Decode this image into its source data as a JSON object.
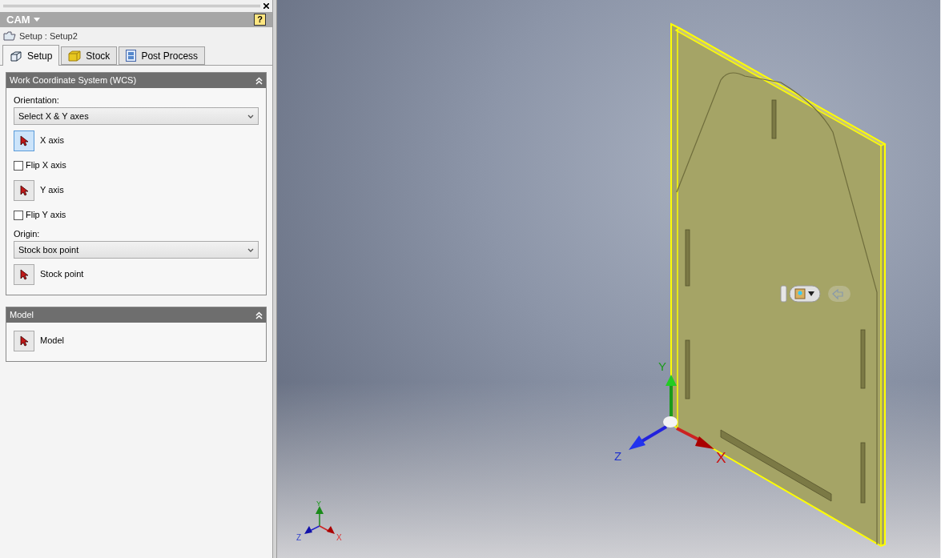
{
  "panel": {
    "title": "CAM",
    "breadcrumb": "Setup : Setup2",
    "help_button": "?"
  },
  "tabs": [
    {
      "label": "Setup",
      "kind": "setup",
      "selected": true
    },
    {
      "label": "Stock",
      "kind": "stock",
      "selected": false
    },
    {
      "label": "Post Process",
      "kind": "post",
      "selected": false
    }
  ],
  "sections": [
    {
      "title": "Work Coordinate System (WCS)",
      "expanded": true,
      "rows": [
        {
          "kind": "label",
          "text": "Orientation:"
        },
        {
          "kind": "dropdown",
          "value": "Select X & Y axes"
        },
        {
          "kind": "picker",
          "label": "X axis",
          "selected": true
        },
        {
          "kind": "checkbox",
          "label": "Flip X axis",
          "checked": false
        },
        {
          "kind": "picker",
          "label": "Y axis",
          "selected": false
        },
        {
          "kind": "checkbox",
          "label": "Flip Y axis",
          "checked": false
        },
        {
          "kind": "label",
          "text": "Origin:"
        },
        {
          "kind": "dropdown",
          "value": "Stock box point"
        },
        {
          "kind": "picker",
          "label": "Stock point",
          "selected": false
        }
      ]
    },
    {
      "title": "Model",
      "expanded": true,
      "rows": [
        {
          "kind": "picker",
          "label": "Model",
          "selected": false
        }
      ]
    }
  ],
  "viewport": {
    "triad_labels": [
      "Y",
      "Z",
      "X"
    ],
    "mini_triad_labels": [
      "Y",
      "Z",
      "X"
    ]
  }
}
